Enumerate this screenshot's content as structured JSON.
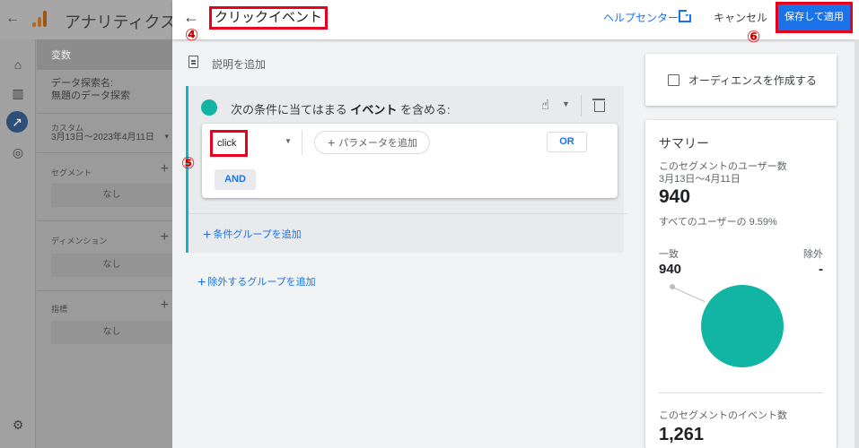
{
  "background_app": {
    "back_arrow": "←",
    "title": "アナリティクス",
    "panel_header": "変数",
    "exploration_label": "データ探索名:",
    "exploration_name": "無題のデータ探索",
    "date_tag": "カスタム",
    "date_range": "3月13日～2023年4月11日",
    "segments_label": "セグメント",
    "dimensions_label": "ディメンション",
    "metrics_label": "指標",
    "empty_label": "なし",
    "plus": "+",
    "caret": "▾"
  },
  "header": {
    "back_arrow": "←",
    "segment_title": "クリックイベント",
    "help_link": "ヘルプセンター",
    "cancel_label": "キャンセル",
    "save_label": "保存して適用"
  },
  "callouts": {
    "c4": "④",
    "c5": "⑤",
    "c6": "⑥"
  },
  "builder": {
    "description_placeholder": "説明を追加",
    "condition_group": {
      "prefix": "次の条件に当てはまる ",
      "keyword": "イベント",
      "suffix": " を含める:",
      "event_name": "click",
      "add_parameter_label": "パラメータを追加",
      "or_label": "OR",
      "and_label": "AND"
    },
    "add_condition_group_label": "条件グループを追加",
    "add_exclude_group_label": "除外するグループを追加"
  },
  "audience": {
    "label": "オーディエンスを作成する"
  },
  "summary": {
    "title": "サマリー",
    "users_label": "このセグメントのユーザー数",
    "date_range": "3月13日～4月11日",
    "users_count": "940",
    "users_pct_text": "すべてのユーザーの 9.59%",
    "match_label": "一致",
    "exclude_label": "除外",
    "match_value": "940",
    "exclude_value": "-",
    "events_label": "このセグメントのイベント数",
    "events_count": "1,261"
  },
  "colors": {
    "accent": "#1a73e8",
    "segment_teal": "#12b5a4",
    "highlight_red": "#e8001c"
  }
}
